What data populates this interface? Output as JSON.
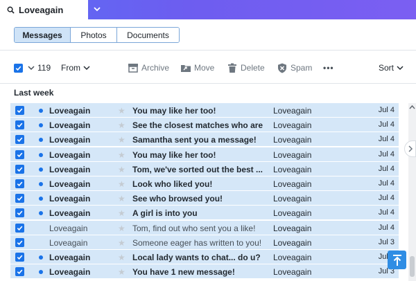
{
  "search": {
    "query": "Loveagain"
  },
  "filters": {
    "tabs": [
      "Messages",
      "Photos",
      "Documents"
    ],
    "active": "Messages"
  },
  "toolbar": {
    "selected_count": "119",
    "from_label": "From",
    "archive_label": "Archive",
    "move_label": "Move",
    "delete_label": "Delete",
    "spam_label": "Spam",
    "more_label": "•••",
    "sort_label": "Sort"
  },
  "section_label": "Last week",
  "messages": [
    {
      "from": "Loveagain",
      "subject": "You may like her too!",
      "sender": "Loveagain",
      "date": "Jul 4",
      "unread": true,
      "checked": true
    },
    {
      "from": "Loveagain",
      "subject": "See the closest matches who are ...",
      "sender": "Loveagain",
      "date": "Jul 4",
      "unread": true,
      "checked": true
    },
    {
      "from": "Loveagain",
      "subject": "Samantha sent you a message!",
      "sender": "Loveagain",
      "date": "Jul 4",
      "unread": true,
      "checked": true
    },
    {
      "from": "Loveagain",
      "subject": "You may like her too!",
      "sender": "Loveagain",
      "date": "Jul 4",
      "unread": true,
      "checked": true
    },
    {
      "from": "Loveagain",
      "subject": "Tom, we've sorted out the best ...",
      "sender": "Loveagain",
      "date": "Jul 4",
      "unread": true,
      "checked": true
    },
    {
      "from": "Loveagain",
      "subject": "Look who liked you!",
      "sender": "Loveagain",
      "date": "Jul 4",
      "unread": true,
      "checked": true
    },
    {
      "from": "Loveagain",
      "subject": "See who browsed you!",
      "sender": "Loveagain",
      "date": "Jul 4",
      "unread": true,
      "checked": true
    },
    {
      "from": "Loveagain",
      "subject": "A girl is into you",
      "sender": "Loveagain",
      "date": "Jul 4",
      "unread": true,
      "checked": true
    },
    {
      "from": "Loveagain",
      "subject": "Tom, find out who sent you a like!",
      "sender": "Loveagain",
      "date": "Jul 4",
      "unread": false,
      "checked": true
    },
    {
      "from": "Loveagain",
      "subject": "Someone eager has written to you!",
      "sender": "Loveagain",
      "date": "Jul 3",
      "unread": false,
      "checked": true
    },
    {
      "from": "Loveagain",
      "subject": "Local lady wants to chat... do u?",
      "sender": "Loveagain",
      "date": "Jul 3",
      "unread": true,
      "checked": true
    },
    {
      "from": "Loveagain",
      "subject": "You have 1 new message!",
      "sender": "Loveagain",
      "date": "Jul 3",
      "unread": true,
      "checked": true
    }
  ],
  "colors": {
    "accent": "#1a73e8",
    "row_selected": "#d5e7f8",
    "topbar": "#6d5df0"
  }
}
